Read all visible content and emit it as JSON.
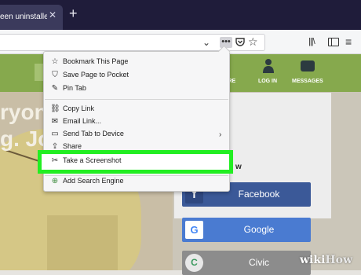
{
  "browser": {
    "tab": {
      "title": "een uninstalled",
      "close_glyph": "✕",
      "new_tab_glyph": "+"
    },
    "toolbar": {
      "url_dropdown_glyph": "⌄",
      "page_actions_glyph": "•••",
      "star_glyph": "☆",
      "library_glyph": "|||\\",
      "menu_glyph": "≡"
    }
  },
  "page": {
    "nav": {
      "more_label": "ORE",
      "login_label": "LOG IN",
      "messages_label": "MESSAGES"
    },
    "hero": {
      "line1": "ryone",
      "line2": "g. Joi"
    },
    "login_card": {
      "heading": "w",
      "buttons": [
        {
          "label": "Facebook",
          "icon": "f"
        },
        {
          "label": "Google",
          "icon": "G"
        },
        {
          "label": "Civic",
          "icon": "C"
        }
      ]
    },
    "watermark": {
      "wiki": "wiki",
      "how": "How"
    }
  },
  "menu": {
    "items": [
      {
        "label": "Bookmark This Page",
        "icon": "☆",
        "icon_name": "star-icon"
      },
      {
        "label": "Save Page to Pocket",
        "icon": "⛉",
        "icon_name": "pocket-icon"
      },
      {
        "label": "Pin Tab",
        "icon": "✎",
        "icon_name": "pin-icon"
      },
      {
        "label": "Copy Link",
        "icon": "⛓",
        "icon_name": "link-icon"
      },
      {
        "label": "Email Link...",
        "icon": "✉",
        "icon_name": "email-icon"
      },
      {
        "label": "Send Tab to Device",
        "icon": "▭",
        "icon_name": "device-icon"
      },
      {
        "label": "Share",
        "icon": "⇪",
        "icon_name": "share-icon"
      },
      {
        "label": "Take a Screenshot",
        "icon": "✂",
        "icon_name": "scissors-icon"
      },
      {
        "label": "Add Search Engine",
        "icon": "⊕",
        "icon_name": "search-engine-icon"
      }
    ],
    "submenu_glyph": "›"
  },
  "colors": {
    "highlight": "#22ee22",
    "site_header": "#86a94d",
    "facebook": "#3b5998",
    "google": "#4a7bd1"
  }
}
